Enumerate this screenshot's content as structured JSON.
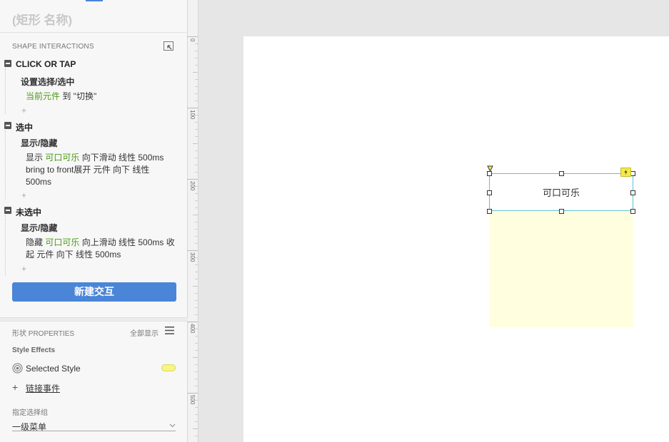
{
  "left_panel": {
    "shape_name_placeholder": "(矩形 名称)",
    "interactions_title": "SHAPE INTERACTIONS",
    "events": [
      {
        "event": "CLICK OR TAP",
        "action": "设置选择/选中",
        "details": [
          {
            "target": "当前元件",
            "rest": " 到 \"切换\""
          }
        ]
      },
      {
        "event": "选中",
        "action": "显示/隐藏",
        "details": [
          {
            "prefix": "显示 ",
            "target": "可口可乐",
            "rest": " 向下滑动 线性 500ms"
          },
          {
            "text": "bring to front展开 元件 向下 线性"
          },
          {
            "text": "500ms"
          }
        ]
      },
      {
        "event": "未选中",
        "action": "显示/隐藏",
        "details": [
          {
            "prefix": "隐藏 ",
            "target": "可口可乐",
            "rest": " 向上滑动 线性 500ms 收"
          },
          {
            "text": "起 元件 向下 线性 500ms"
          }
        ]
      }
    ],
    "add_symbol": "+",
    "new_interaction_button": "新建交互",
    "properties_title": "形状 PROPERTIES",
    "show_all": "全部显示",
    "style_effects_title": "Style Effects",
    "selected_style_label": "Selected Style",
    "selected_style_color": "#f6f681",
    "link_event_icon": "+",
    "link_event_label": "链接事件",
    "group_title": "指定选择组",
    "group_value": "一级菜单"
  },
  "ruler": {
    "labels": [
      "0",
      "100",
      "200",
      "300",
      "400",
      "500"
    ]
  },
  "canvas": {
    "selected_shape_text": "可口可乐",
    "dropdown_fill_color": "#ffffdf",
    "selection_border_color": "#5bc4d1"
  },
  "colors": {
    "accent": "#4a85d8",
    "link_green": "#4a9a16"
  }
}
